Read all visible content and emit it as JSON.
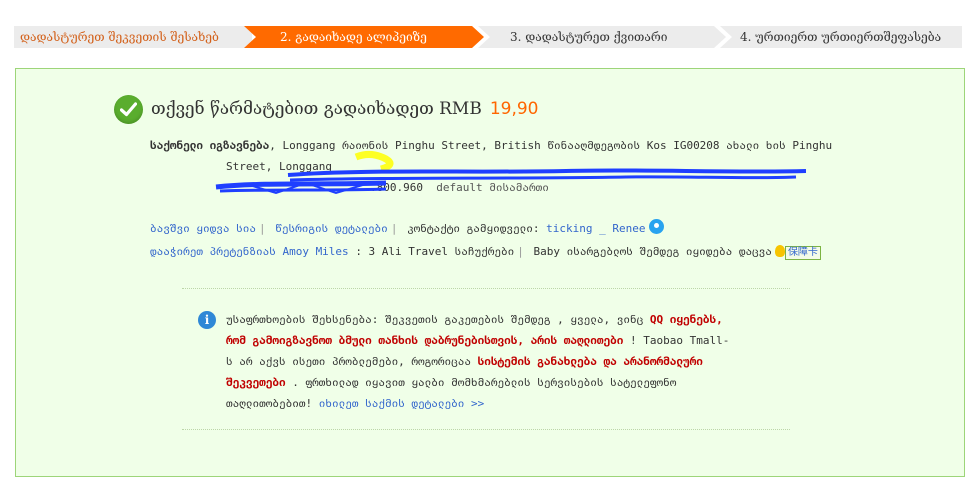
{
  "steps": [
    {
      "label": "დადასტურეთ შეკვეთის შესახებ"
    },
    {
      "label": "2. გადაიხადე ალიპეიზე"
    },
    {
      "label": "3. დადასტურეთ ქვითარი"
    },
    {
      "label": "4. ურთიერთ ურთიერთშეფასება"
    }
  ],
  "success": {
    "headline": "თქვენ წარმატებით გადაიხადეთ RMB",
    "amount": "19,90"
  },
  "shipping": {
    "label": "საქონელი იგზავნება",
    "line1_text": ", Longgang რაიონის Pinghu Street, British წინააღმდეგობის Kos IG00208 ახალი ხის Pinghu",
    "line2_text": "Street, Longgang",
    "line3_tail": ".800.960",
    "default_tag": "default მისამართი"
  },
  "links": {
    "cart": "ბავშვი ყიდვა სია",
    "order_details": "წესრიგის დეტალები",
    "contact_label": "კონტაქტი გამყიდველი:",
    "seller_name": "ticking _ Renee",
    "recommend": "დააჭირეთ პრეტენზიას Amoy Miles",
    "partner": ": 3 Ali Travel საჩუქრები",
    "baby_note": "Baby ისარგებლოს შემდეგ იყიდება დაცვა",
    "baby_badge": "保障卡"
  },
  "notice": {
    "intro": "უსაფრთხოების შეხსენება: შეკვეთის გაკეთების შემდეგ , ყველა, ვინც",
    "red1": "QQ იყენებს, რომ გამოიგზავნოთ ბმული თანხის დაბრუნებისთვის, არის თაღლითები",
    "after_red1": " ! Taobao Tmall- ს არ აქვს ისეთი პრობლემები, როგორიცაა ",
    "red2": "სისტემის განახლება და არანორმალური შეკვეთები",
    "after_red2": " . ფრთხილად იყავით ყალბი მომხმარებლის სერვისების სატელეფონო თაღლითობებით!",
    "link": "იხილეთ საქმის დეტალები >>"
  },
  "colors": {
    "accent": "#ff6a00",
    "panel_bg": "#f0ffe8",
    "panel_border": "#9dd579",
    "success": "#5aad2e",
    "link": "#3366cc",
    "warning_red": "#c00000"
  },
  "icons": [
    "check-circle-icon",
    "wangwang-chat-icon",
    "bulb-icon",
    "info-icon"
  ]
}
